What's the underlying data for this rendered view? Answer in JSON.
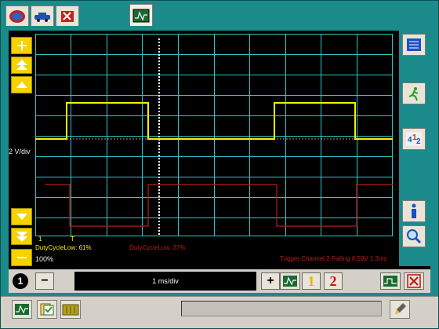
{
  "left_panel": {
    "vdiv": "2 V/div",
    "channel_marker": "1"
  },
  "scope": {
    "zoom_level": "100%",
    "cursor_marker": "T",
    "measurements": {
      "duty_cycle_low_1": "DutyCycleLow: 61%",
      "duty_cycle_low_2": "DutyCycleLow: 37%",
      "trigger_info": "Trigger Channel 2 Falling 0.59V 1.3ms"
    }
  },
  "timebase": {
    "value": "1 ms/div",
    "minus_label": "−",
    "plus_label": "+",
    "channel_1_label": "1",
    "channel_2_label": "2",
    "channel_indicator": "1"
  },
  "colors": {
    "background": "#1a8a8a",
    "grid": "#2fc6c6",
    "channel_1": "#f5f000",
    "channel_2": "#c01818",
    "yellow_button": "#f5d200"
  },
  "icons": {
    "tab_1": "car-badge-icon",
    "tab_2": "car-icon",
    "tab_3": "tools-icon",
    "tab_4": "scope-wave-icon",
    "right_1": "list-icon",
    "right_2": "runner-icon",
    "right_3": "numbers-icon",
    "right_4": "info-icon",
    "right_5": "magnifier-icon",
    "right_6": "stop-icon"
  }
}
